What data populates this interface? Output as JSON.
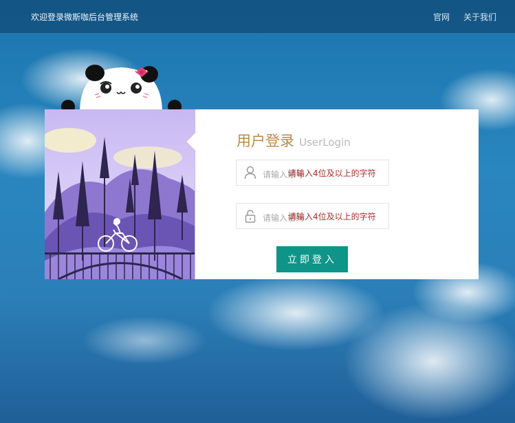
{
  "header": {
    "title": "欢迎登录微斯咖后台管理系统",
    "nav": [
      {
        "label": "官网"
      },
      {
        "label": "关于我们"
      }
    ]
  },
  "login": {
    "title_cn": "用户登录",
    "title_en": "UserLogin",
    "username": {
      "placeholder": "请输入账号",
      "hint": "请输入4位及以上的字符",
      "icon": "user-icon"
    },
    "password": {
      "placeholder": "请输入密码",
      "hint": "请输入4位及以上的字符",
      "icon": "lock-icon"
    },
    "submit_label": "立即登入"
  },
  "colors": {
    "accent": "#0e9588",
    "heading": "#b88a4b",
    "hint": "#b12a2a"
  }
}
